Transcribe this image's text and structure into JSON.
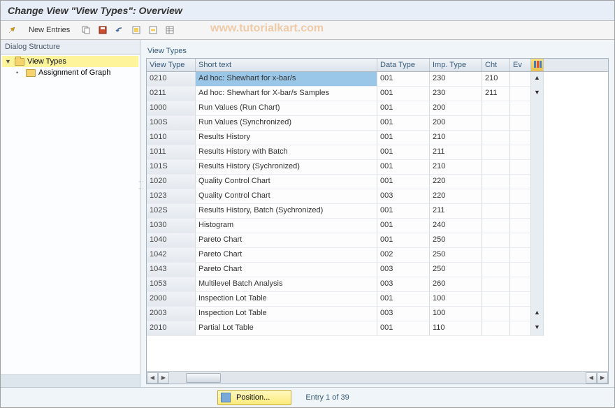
{
  "title": "Change View \"View Types\": Overview",
  "toolbar": {
    "new_entries_label": "New Entries"
  },
  "watermark": "www.tutorialkart.com",
  "sidebar": {
    "header": "Dialog Structure",
    "items": [
      {
        "label": "View Types",
        "selected": true
      },
      {
        "label": "Assignment of Graph"
      }
    ]
  },
  "panel": {
    "title": "View Types"
  },
  "table": {
    "headers": {
      "view_type": "View Type",
      "short_text": "Short text",
      "data_type": "Data Type",
      "imp_type": "Imp. Type",
      "cht": "Cht",
      "ev": "Ev"
    },
    "rows": [
      {
        "view_type": "0210",
        "short_text": "Ad hoc: Shewhart for x-bar/s",
        "data_type": "001",
        "imp_type": "230",
        "cht": "210",
        "ev": "",
        "selected": true
      },
      {
        "view_type": "0211",
        "short_text": "Ad hoc: Shewhart for X-bar/s Samples",
        "data_type": "001",
        "imp_type": "230",
        "cht": "211",
        "ev": ""
      },
      {
        "view_type": "1000",
        "short_text": "Run Values (Run Chart)",
        "data_type": "001",
        "imp_type": "200",
        "cht": "",
        "ev": ""
      },
      {
        "view_type": "100S",
        "short_text": "Run Values (Synchronized)",
        "data_type": "001",
        "imp_type": "200",
        "cht": "",
        "ev": ""
      },
      {
        "view_type": "1010",
        "short_text": "Results History",
        "data_type": "001",
        "imp_type": "210",
        "cht": "",
        "ev": ""
      },
      {
        "view_type": "1011",
        "short_text": "Results History with Batch",
        "data_type": "001",
        "imp_type": "211",
        "cht": "",
        "ev": ""
      },
      {
        "view_type": "101S",
        "short_text": "Results History (Sychronized)",
        "data_type": "001",
        "imp_type": "210",
        "cht": "",
        "ev": ""
      },
      {
        "view_type": "1020",
        "short_text": "Quality Control Chart",
        "data_type": "001",
        "imp_type": "220",
        "cht": "",
        "ev": ""
      },
      {
        "view_type": "1023",
        "short_text": "Quality Control Chart",
        "data_type": "003",
        "imp_type": "220",
        "cht": "",
        "ev": ""
      },
      {
        "view_type": "102S",
        "short_text": "Results History, Batch  (Sychronized)",
        "data_type": "001",
        "imp_type": "211",
        "cht": "",
        "ev": ""
      },
      {
        "view_type": "1030",
        "short_text": "Histogram",
        "data_type": "001",
        "imp_type": "240",
        "cht": "",
        "ev": ""
      },
      {
        "view_type": "1040",
        "short_text": "Pareto Chart",
        "data_type": "001",
        "imp_type": "250",
        "cht": "",
        "ev": ""
      },
      {
        "view_type": "1042",
        "short_text": "Pareto Chart",
        "data_type": "002",
        "imp_type": "250",
        "cht": "",
        "ev": ""
      },
      {
        "view_type": "1043",
        "short_text": "Pareto Chart",
        "data_type": "003",
        "imp_type": "250",
        "cht": "",
        "ev": ""
      },
      {
        "view_type": "1053",
        "short_text": "Multilevel Batch Analysis",
        "data_type": "003",
        "imp_type": "260",
        "cht": "",
        "ev": ""
      },
      {
        "view_type": "2000",
        "short_text": "Inspection Lot Table",
        "data_type": "001",
        "imp_type": "100",
        "cht": "",
        "ev": ""
      },
      {
        "view_type": "2003",
        "short_text": "Inspection Lot Table",
        "data_type": "003",
        "imp_type": "100",
        "cht": "",
        "ev": ""
      },
      {
        "view_type": "2010",
        "short_text": "Partial Lot Table",
        "data_type": "001",
        "imp_type": "110",
        "cht": "",
        "ev": ""
      }
    ]
  },
  "footer": {
    "position_label": "Position...",
    "entry_text": "Entry 1 of 39"
  }
}
